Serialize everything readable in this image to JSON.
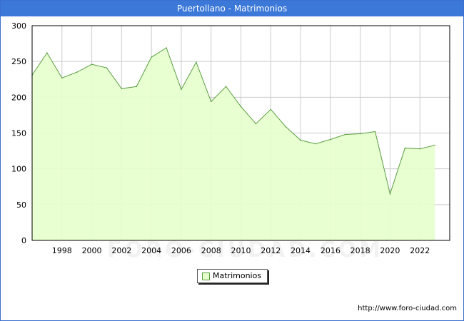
{
  "window": {
    "title": "Puertollano - Matrimonios"
  },
  "watermark": "FORO-CIUDAD.COM",
  "source": "http://www.foro-ciudad.com",
  "colors": {
    "title_bg": "#3b78d8",
    "fill": "#e6ffcc",
    "line": "#5c9e44",
    "grid": "#cccccc"
  },
  "chart_data": {
    "type": "area",
    "title": "Puertollano - Matrimonios",
    "xlabel": "",
    "ylabel": "",
    "x": [
      1996,
      1997,
      1998,
      1999,
      2000,
      2001,
      2002,
      2003,
      2004,
      2005,
      2006,
      2007,
      2008,
      2009,
      2010,
      2011,
      2012,
      2013,
      2014,
      2015,
      2016,
      2017,
      2018,
      2019,
      2020,
      2021,
      2022,
      2023
    ],
    "series": [
      {
        "name": "Matrimonios",
        "values": [
          231,
          262,
          227,
          235,
          246,
          241,
          212,
          215,
          256,
          269,
          211,
          249,
          194,
          215,
          187,
          163,
          183,
          159,
          140,
          135,
          141,
          148,
          149,
          152,
          65,
          129,
          128,
          133
        ]
      }
    ],
    "xlim": [
      1996,
      2024
    ],
    "ylim": [
      0,
      300
    ],
    "xticks": [
      1998,
      2000,
      2002,
      2004,
      2006,
      2008,
      2010,
      2012,
      2014,
      2016,
      2018,
      2020,
      2022
    ],
    "yticks": [
      0,
      50,
      100,
      150,
      200,
      250,
      300
    ],
    "grid": true,
    "legend_position": "bottom-center"
  }
}
